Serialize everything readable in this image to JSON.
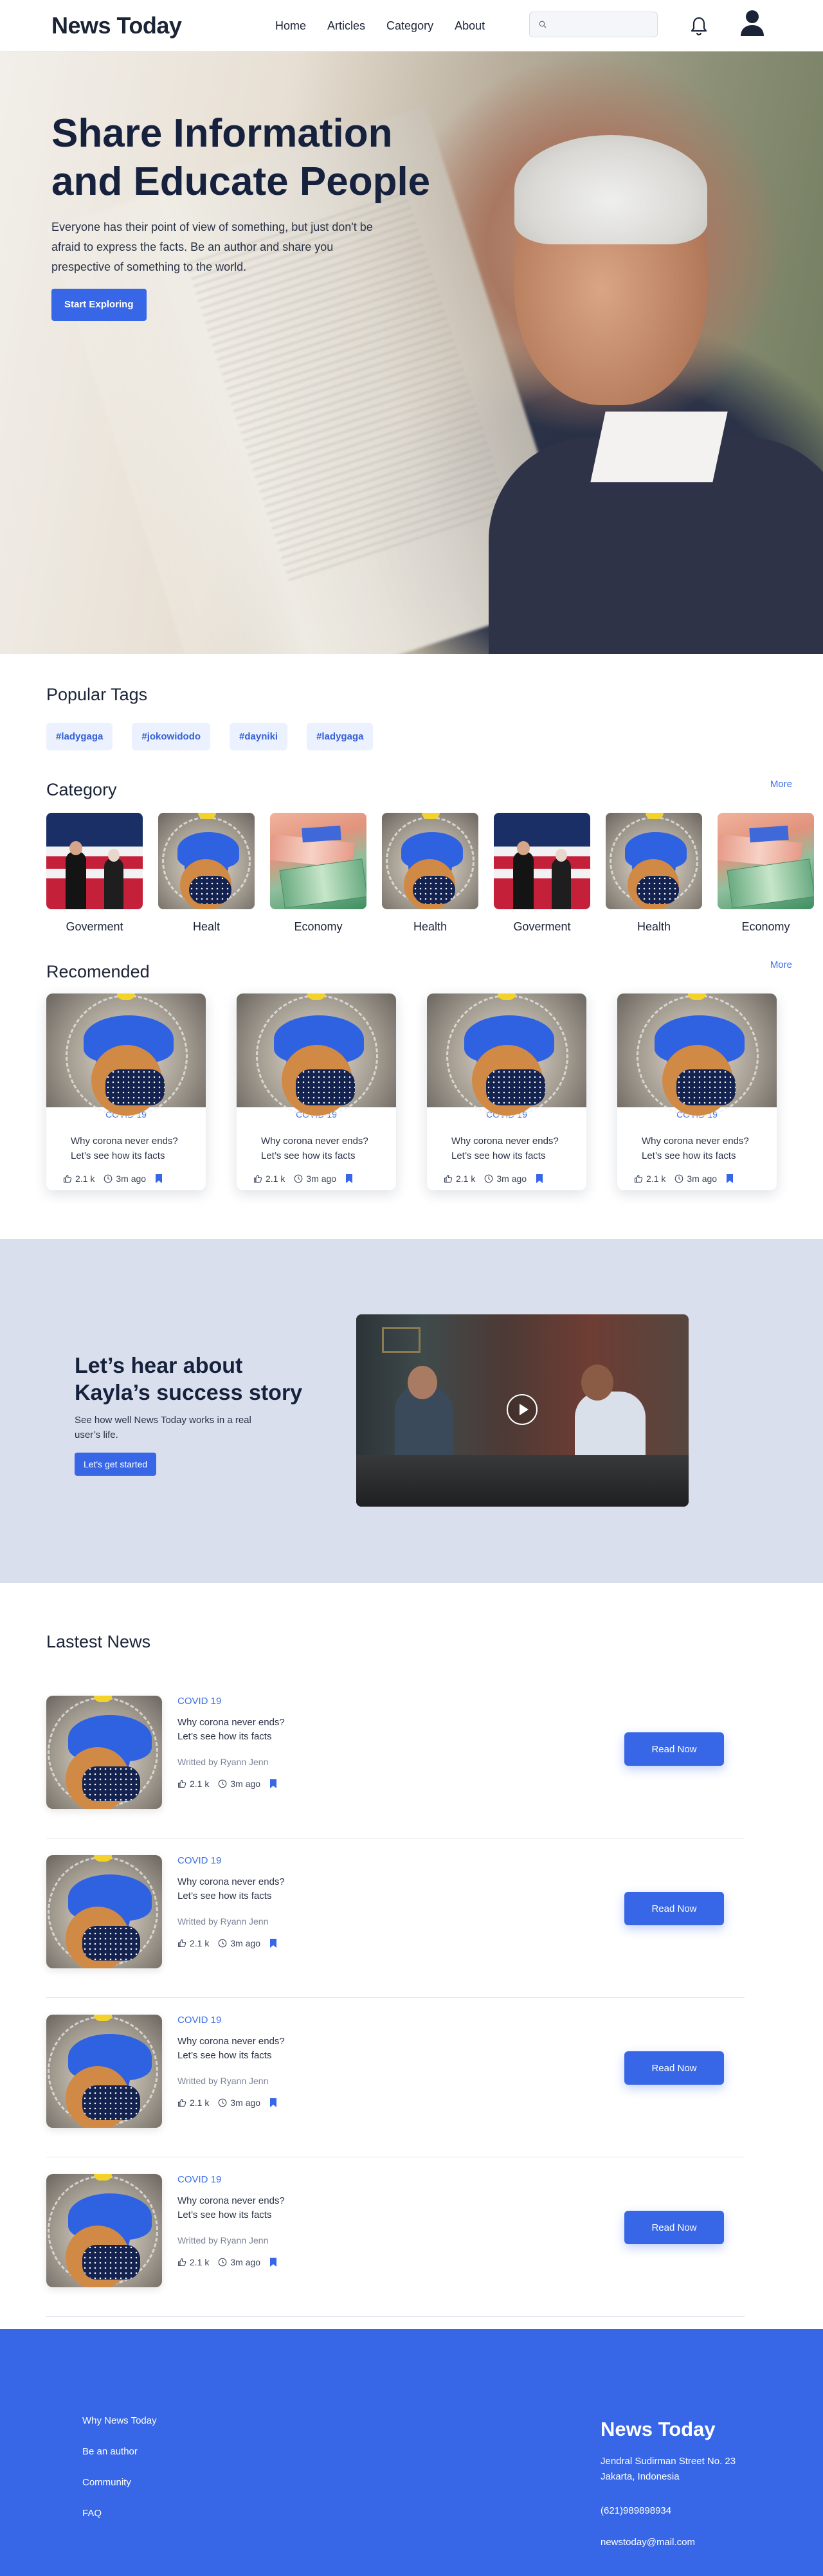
{
  "nav": {
    "logo": "News Today",
    "menu": [
      "Home",
      "Articles",
      "Category",
      "About"
    ],
    "search_placeholder": ""
  },
  "hero": {
    "title_line1": "Share Information",
    "title_line2": "and Educate People",
    "description": "Everyone has their point of view of something, but just don't be afraid to express the facts. Be an author and share you prespective of something to the world.",
    "button": "Start Exploring"
  },
  "tags": {
    "title": "Popular Tags",
    "items": [
      "#ladygaga",
      "#jokowidodo",
      "#dayniki",
      "#ladygaga"
    ]
  },
  "category": {
    "title": "Category",
    "more": "More",
    "items": [
      {
        "label": "Goverment",
        "image": "politics"
      },
      {
        "label": "Healt",
        "image": "covid"
      },
      {
        "label": "Economy",
        "image": "money"
      },
      {
        "label": "Health",
        "image": "covid"
      },
      {
        "label": "Goverment",
        "image": "politics"
      },
      {
        "label": "Health",
        "image": "covid"
      },
      {
        "label": "Economy",
        "image": "money"
      }
    ]
  },
  "recomended": {
    "title": "Recomended",
    "more": "More",
    "cards": [
      {
        "category": "COVID 19",
        "title": "Why corona never ends? Let’s see how its facts",
        "likes": "2.1 k",
        "time": "3m ago"
      },
      {
        "category": "COVID 19",
        "title": "Why corona never ends? Let’s see how its facts",
        "likes": "2.1 k",
        "time": "3m ago"
      },
      {
        "category": "COVID 19",
        "title": "Why corona never ends? Let’s see how its facts",
        "likes": "2.1 k",
        "time": "3m ago"
      },
      {
        "category": "COVID 19",
        "title": "Why corona never ends? Let’s see how its facts",
        "likes": "2.1 k",
        "time": "3m ago"
      }
    ]
  },
  "story": {
    "title_line1": "Let’s hear about",
    "title_line2": "Kayla’s success story",
    "description": "See how well News Today works in a real user’s life.",
    "button": "Let's get started"
  },
  "latest": {
    "title": "Lastest News",
    "items": [
      {
        "category": "COVID 19",
        "title_line1": "Why corona never ends?",
        "title_line2": "Let’s see how its facts",
        "author": "Writted by Ryann Jenn",
        "likes": "2.1 k",
        "time": "3m ago",
        "button": "Read Now"
      },
      {
        "category": "COVID 19",
        "title_line1": "Why corona never ends?",
        "title_line2": "Let’s see how its facts",
        "author": "Writted by Ryann Jenn",
        "likes": "2.1 k",
        "time": "3m ago",
        "button": "Read Now"
      },
      {
        "category": "COVID 19",
        "title_line1": "Why corona never ends?",
        "title_line2": "Let’s see how its facts",
        "author": "Writted by Ryann Jenn",
        "likes": "2.1 k",
        "time": "3m ago",
        "button": "Read Now"
      },
      {
        "category": "COVID 19",
        "title_line1": "Why corona never ends?",
        "title_line2": "Let’s see how its facts",
        "author": "Writted by Ryann Jenn",
        "likes": "2.1 k",
        "time": "3m ago",
        "button": "Read Now"
      }
    ]
  },
  "footer": {
    "links": [
      "Why News Today",
      "Be an author",
      "Community",
      "FAQ"
    ],
    "brand": "News Today",
    "address_line1": "Jendral Sudirman Street No. 23",
    "address_line2": "Jakarta, Indonesia",
    "phone": "(621)989898934",
    "email": "newstoday@mail.com"
  },
  "colors": {
    "accent": "#3767e7",
    "story_bg": "#dadfed",
    "tag_bg": "#ebf1ff"
  }
}
